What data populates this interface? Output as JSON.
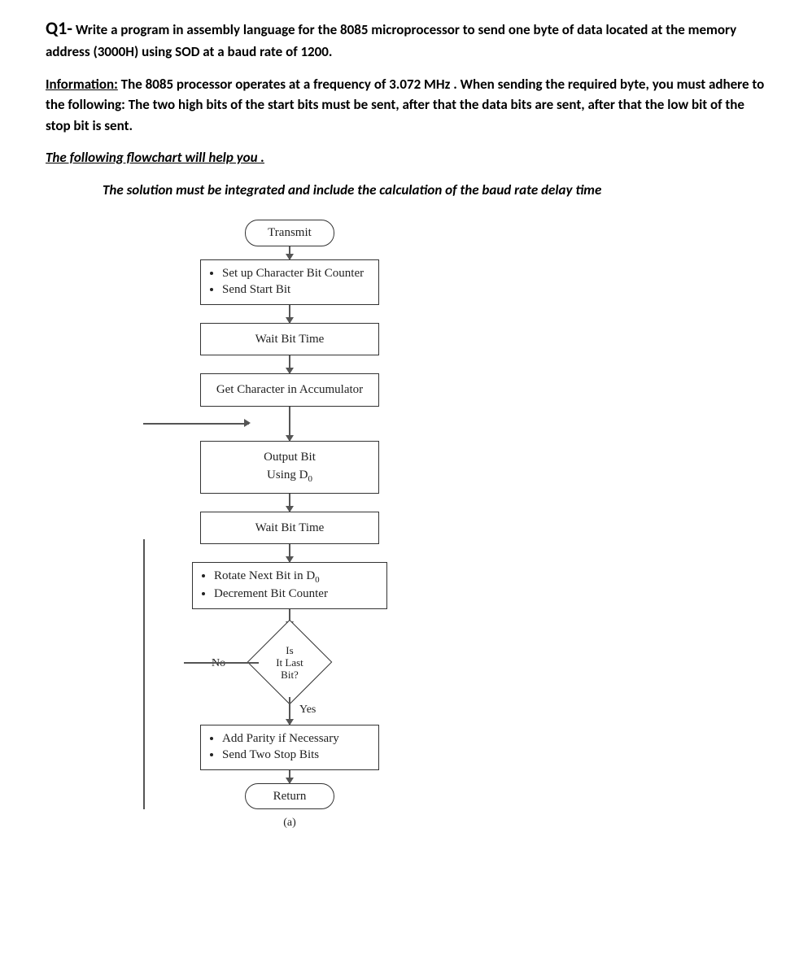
{
  "question": {
    "label": "Q1-",
    "text_part1": " Write a program in assembly language for the 8085 microprocessor to send one byte of data located at the memory address (3000H) using SOD at a baud rate of 1200."
  },
  "info": {
    "label": "Information:",
    "text": " The 8085 processor operates at a frequency of 3.072 MHz . When sending the required byte, you must adhere to the following: The two high bits of the start bits must be sent, after that the data bits  are sent, after that the low bit of the stop bit is sent."
  },
  "helper_intro": "The following flowchart will help you .",
  "helper_note": "The solution must be integrated and include the calculation of the baud rate delay time",
  "flow": {
    "start": "Transmit",
    "step1a": "Set up Character Bit Counter",
    "step1b": "Send Start Bit",
    "step2": "Wait Bit Time",
    "step3": "Get Character in Accumulator",
    "step4a": "Output Bit",
    "step4b": "Using D",
    "step4b_sub": "0",
    "step5": "Wait Bit Time",
    "step6a": "Rotate Next Bit in D",
    "step6a_sub": "0",
    "step6b": "Decrement Bit Counter",
    "decision1": "Is",
    "decision2": "It Last",
    "decision3": "Bit?",
    "no": "No",
    "yes": "Yes",
    "step7a": "Add Parity if Necessary",
    "step7b": "Send Two Stop Bits",
    "end": "Return",
    "caption": "(a)"
  }
}
